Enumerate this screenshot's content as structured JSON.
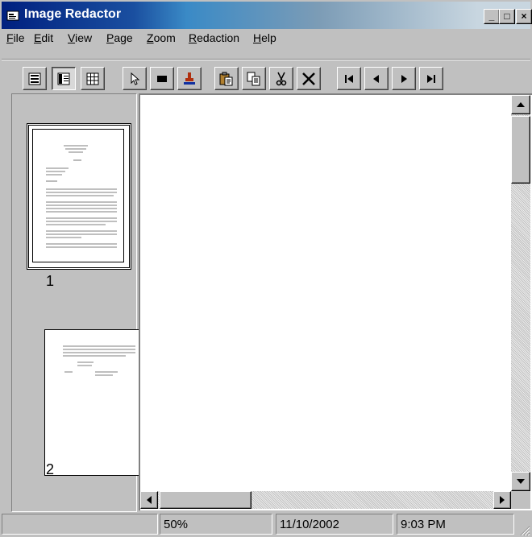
{
  "window": {
    "title": "Image Redactor",
    "controls": {
      "minimize": "_",
      "maximize": "□",
      "close": "×"
    }
  },
  "menu": [
    {
      "label": "File",
      "mnemonic": "F",
      "rest": "ile"
    },
    {
      "label": "Edit",
      "mnemonic": "E",
      "rest": "dit"
    },
    {
      "label": "View",
      "mnemonic": "V",
      "rest": "iew"
    },
    {
      "label": "Page",
      "mnemonic": "P",
      "rest": "age"
    },
    {
      "label": "Zoom",
      "mnemonic": "Z",
      "rest": "oom"
    },
    {
      "label": "Redaction",
      "mnemonic": "R",
      "rest": "edaction"
    },
    {
      "label": "Help",
      "mnemonic": "H",
      "rest": "elp"
    }
  ],
  "toolbar": {
    "buttons": [
      {
        "name": "single-page-view-button",
        "icon": "single-page-icon"
      },
      {
        "name": "thumbnail-view-button",
        "icon": "thumbnail-view-icon",
        "pressed": true
      },
      {
        "name": "grid-view-button",
        "icon": "grid-view-icon"
      },
      {
        "name": "pointer-tool-button",
        "icon": "pointer-icon"
      },
      {
        "name": "redact-box-button",
        "icon": "redact-box-icon"
      },
      {
        "name": "stamp-button",
        "icon": "stamp-icon"
      },
      {
        "name": "paste-button",
        "icon": "paste-icon"
      },
      {
        "name": "copy-button",
        "icon": "copy-icon"
      },
      {
        "name": "cut-button",
        "icon": "scissors-icon"
      },
      {
        "name": "delete-button",
        "icon": "delete-x-icon"
      },
      {
        "name": "first-page-button",
        "icon": "first-page-icon"
      },
      {
        "name": "previous-page-button",
        "icon": "previous-page-icon"
      },
      {
        "name": "next-page-button",
        "icon": "next-page-icon"
      },
      {
        "name": "last-page-button",
        "icon": "last-page-icon"
      }
    ]
  },
  "thumbnails": [
    {
      "page": "1",
      "selected": true
    },
    {
      "page": "2",
      "selected": false
    }
  ],
  "status": {
    "message": "",
    "zoom": "50%",
    "date": "11/10/2002",
    "time": "9:03 PM"
  }
}
